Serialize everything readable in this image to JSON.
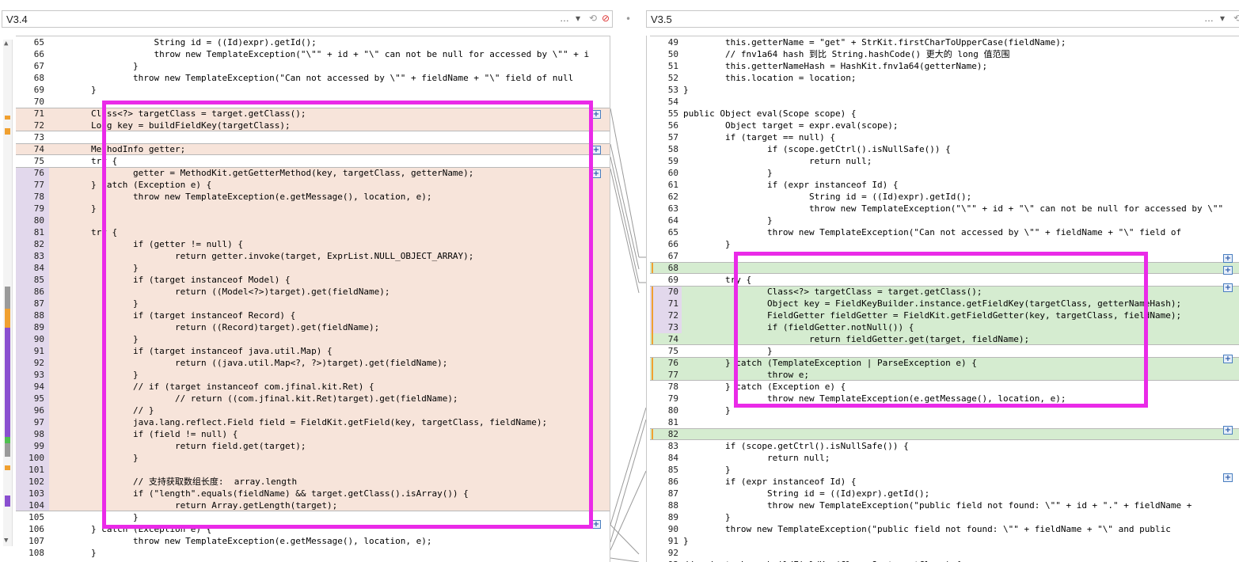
{
  "colors": {
    "removed": "#f7e4da",
    "added": "#d5ecd0",
    "gutter_changed": "#e2d8ec",
    "highlight": "#ea2ae8",
    "change_marker": "#f0a030"
  },
  "left": {
    "title": "V3.4",
    "start": 65,
    "lines": [
      "                    String id = ((Id)expr).getId();",
      "                    throw new TemplateException(\"\\\"\" + id + \"\\\" can not be null for accessed by \\\"\" + i",
      "                }",
      "                throw new TemplateException(\"Can not accessed by \\\"\" + fieldName + \"\\\" field of null",
      "        }",
      "",
      "        Class<?> targetClass = target.getClass();",
      "        Long key = buildFieldKey(targetClass);",
      "",
      "        MethodInfo getter;",
      "        try {",
      "                getter = MethodKit.getGetterMethod(key, targetClass, getterName);",
      "        } catch (Exception e) {",
      "                throw new TemplateException(e.getMessage(), location, e);",
      "        }",
      "",
      "        try {",
      "                if (getter != null) {",
      "                        return getter.invoke(target, ExprList.NULL_OBJECT_ARRAY);",
      "                }",
      "                if (target instanceof Model) {",
      "                        return ((Model<?>)target).get(fieldName);",
      "                }",
      "                if (target instanceof Record) {",
      "                        return ((Record)target).get(fieldName);",
      "                }",
      "                if (target instanceof java.util.Map) {",
      "                        return ((java.util.Map<?, ?>)target).get(fieldName);",
      "                }",
      "                // if (target instanceof com.jfinal.kit.Ret) {",
      "                        // return ((com.jfinal.kit.Ret)target).get(fieldName);",
      "                // }",
      "                java.lang.reflect.Field field = FieldKit.getField(key, targetClass, fieldName);",
      "                if (field != null) {",
      "                        return field.get(target);",
      "                }",
      "",
      "                // 支持获取数组长度:  array.length",
      "                if (\"length\".equals(fieldName) && target.getClass().isArray()) {",
      "                        return Array.getLength(target);",
      "                }",
      "        } catch (Exception e) {",
      "                throw new TemplateException(e.getMessage(), location, e);",
      "        }"
    ],
    "types": [
      "n",
      "n",
      "n",
      "n",
      "n",
      "n",
      "r",
      "r",
      "n",
      "r",
      "n",
      "rm",
      "rm",
      "rm",
      "rm",
      "rm",
      "rm",
      "rm",
      "rm",
      "rm",
      "rm",
      "rm",
      "rm",
      "rm",
      "rm",
      "rm",
      "rm",
      "rm",
      "rm",
      "rm",
      "rm",
      "rm",
      "rm",
      "rm",
      "rm",
      "rm",
      "rm",
      "rm",
      "rm",
      "rm",
      "n",
      "n",
      "n",
      "n"
    ]
  },
  "right": {
    "title": "V3.5",
    "start": 49,
    "lines": [
      "        this.getterName = \"get\" + StrKit.firstCharToUpperCase(fieldName);",
      "        // fnv1a64 hash 到比 String.hashCode() 更大的 long 值范围",
      "        this.getterNameHash = HashKit.fnv1a64(getterName);",
      "        this.location = location;",
      "}",
      "",
      "public Object eval(Scope scope) {",
      "        Object target = expr.eval(scope);",
      "        if (target == null) {",
      "                if (scope.getCtrl().isNullSafe()) {",
      "                        return null;",
      "                }",
      "                if (expr instanceof Id) {",
      "                        String id = ((Id)expr).getId();",
      "                        throw new TemplateException(\"\\\"\" + id + \"\\\" can not be null for accessed by \\\"\"",
      "                }",
      "                throw new TemplateException(\"Can not accessed by \\\"\" + fieldName + \"\\\" field of",
      "        }",
      "",
      "",
      "        try {",
      "                Class<?> targetClass = target.getClass();",
      "                Object key = FieldKeyBuilder.instance.getFieldKey(targetClass, getterNameHash);",
      "                FieldGetter fieldGetter = FieldKit.getFieldGetter(key, targetClass, fieldName);",
      "                if (fieldGetter.notNull()) {",
      "                        return fieldGetter.get(target, fieldName);",
      "                }",
      "        } catch (TemplateException | ParseException e) {",
      "                throw e;",
      "        } catch (Exception e) {",
      "                throw new TemplateException(e.getMessage(), location, e);",
      "        }",
      "",
      "",
      "        if (scope.getCtrl().isNullSafe()) {",
      "                return null;",
      "        }",
      "        if (expr instanceof Id) {",
      "                String id = ((Id)expr).getId();",
      "                throw new TemplateException(\"public field not found: \\\"\" + id + \".\" + fieldName +",
      "        }",
      "        throw new TemplateException(\"public field not found: \\\"\" + fieldName + \"\\\" and public",
      "}",
      "",
      "// private Long buildFieldKey(Class<?> targetClass) {"
    ],
    "types": [
      "n",
      "n",
      "n",
      "n",
      "n",
      "n",
      "n",
      "n",
      "n",
      "n",
      "n",
      "n",
      "n",
      "n",
      "n",
      "n",
      "n",
      "n",
      "n",
      "a",
      "n",
      "am",
      "am",
      "am",
      "am",
      "a",
      "n",
      "a",
      "a",
      "n",
      "n",
      "n",
      "n",
      "a",
      "n",
      "n",
      "n",
      "n",
      "n",
      "n",
      "n",
      "n",
      "n",
      "n",
      "n"
    ]
  }
}
